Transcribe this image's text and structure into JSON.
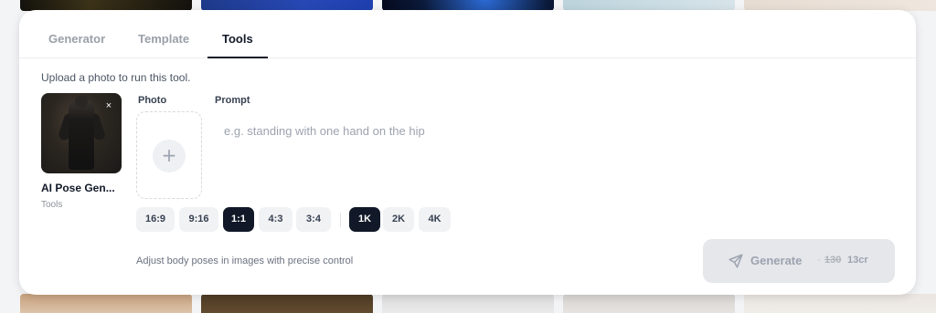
{
  "tabs": [
    {
      "label": "Generator"
    },
    {
      "label": "Template"
    },
    {
      "label": "Tools"
    }
  ],
  "active_tab": "Tools",
  "hint": "Upload a photo to run this tool.",
  "tool": {
    "name": "AI Pose Gen...",
    "category": "Tools",
    "close_icon": "×"
  },
  "photo_label": "Photo",
  "prompt_label": "Prompt",
  "upload_icon": "+",
  "prompt": {
    "value": "",
    "placeholder": "e.g. standing with one hand on the hip"
  },
  "aspect_ratios": [
    "16:9",
    "9:16",
    "1:1",
    "4:3",
    "3:4"
  ],
  "selected_aspect_ratio": "1:1",
  "resolutions": [
    "1K",
    "2K",
    "4K"
  ],
  "selected_resolution": "1K",
  "description": "Adjust body poses in images with precise control",
  "generate": {
    "label": "Generate",
    "separator": "·",
    "old_cost": "130",
    "new_cost": "13cr",
    "icon": "send-icon"
  },
  "colors": {
    "accent": "#111827",
    "pill_bg": "#f1f2f4",
    "button_disabled": "#e5e7eb"
  }
}
